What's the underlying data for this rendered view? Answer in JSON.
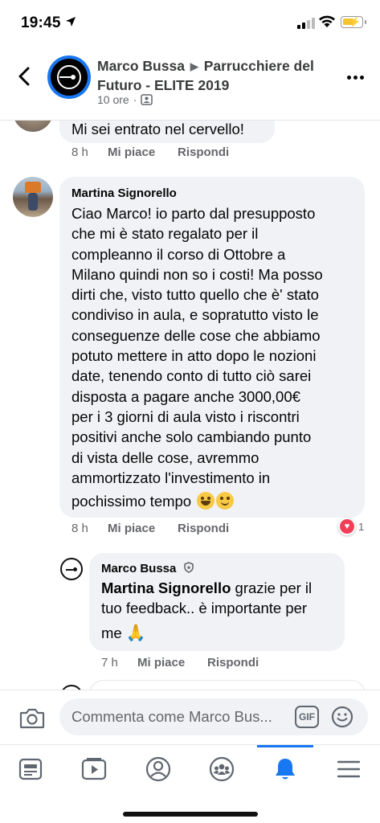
{
  "status_bar": {
    "time": "19:45"
  },
  "header": {
    "author": "Marco Bussa",
    "group": "Parrucchiere del Futuro - ELITE 2019",
    "time_ago": "10 ore",
    "separator": "·"
  },
  "comments": [
    {
      "text": "Mi sei entrato nel cervello!",
      "time": "8 h",
      "like": "Mi piace",
      "reply": "Rispondi"
    },
    {
      "author": "Martina Signorello",
      "text_lines": [
        "Ciao Marco! io parto dal presupposto",
        "che mi è stato regalato per il",
        "compleanno il corso di Ottobre a",
        "Milano quindi non so i costi! Ma posso",
        "dirti che, visto tutto quello che è' stato",
        "condiviso in aula, e sopratutto visto le",
        "conseguenze delle cose che abbiamo",
        "potuto mettere in atto dopo le nozioni",
        "date, tenendo conto di tutto ciò sarei",
        "disposta a pagare anche 3000,00€",
        "per i 3 giorni di aula visto i riscontri",
        "positivi anche solo cambiando punto",
        "di vista delle cose, avremmo",
        "ammortizzato l'investimento in",
        "pochissimo tempo"
      ],
      "time": "8 h",
      "like": "Mi piace",
      "reply": "Rispondi",
      "reaction_count": "1"
    },
    {
      "author": "Marco Bussa",
      "mention": "Martina Signorello",
      "text_lines": [
        " grazie per il",
        "tuo feedback.. è importante per",
        "me"
      ],
      "time": "7 h",
      "like": "Mi piace",
      "reply": "Rispondi"
    }
  ],
  "composer": {
    "placeholder": "Commenta come Marco Bus...",
    "gif_label": "GIF"
  },
  "icons": {
    "navigation": "back-chevron-icon",
    "menu": "more-options-icon",
    "composer": [
      "camera-icon",
      "gif-icon",
      "emoji-icon"
    ],
    "tabs": [
      "news-feed-icon",
      "watch-icon",
      "profile-icon",
      "groups-icon",
      "notifications-icon",
      "menu-icon"
    ]
  },
  "colors": {
    "accent": "#1877f2",
    "bubble": "#f0f2f5",
    "secondary_text": "#65676b",
    "heart": "#f33e58"
  }
}
